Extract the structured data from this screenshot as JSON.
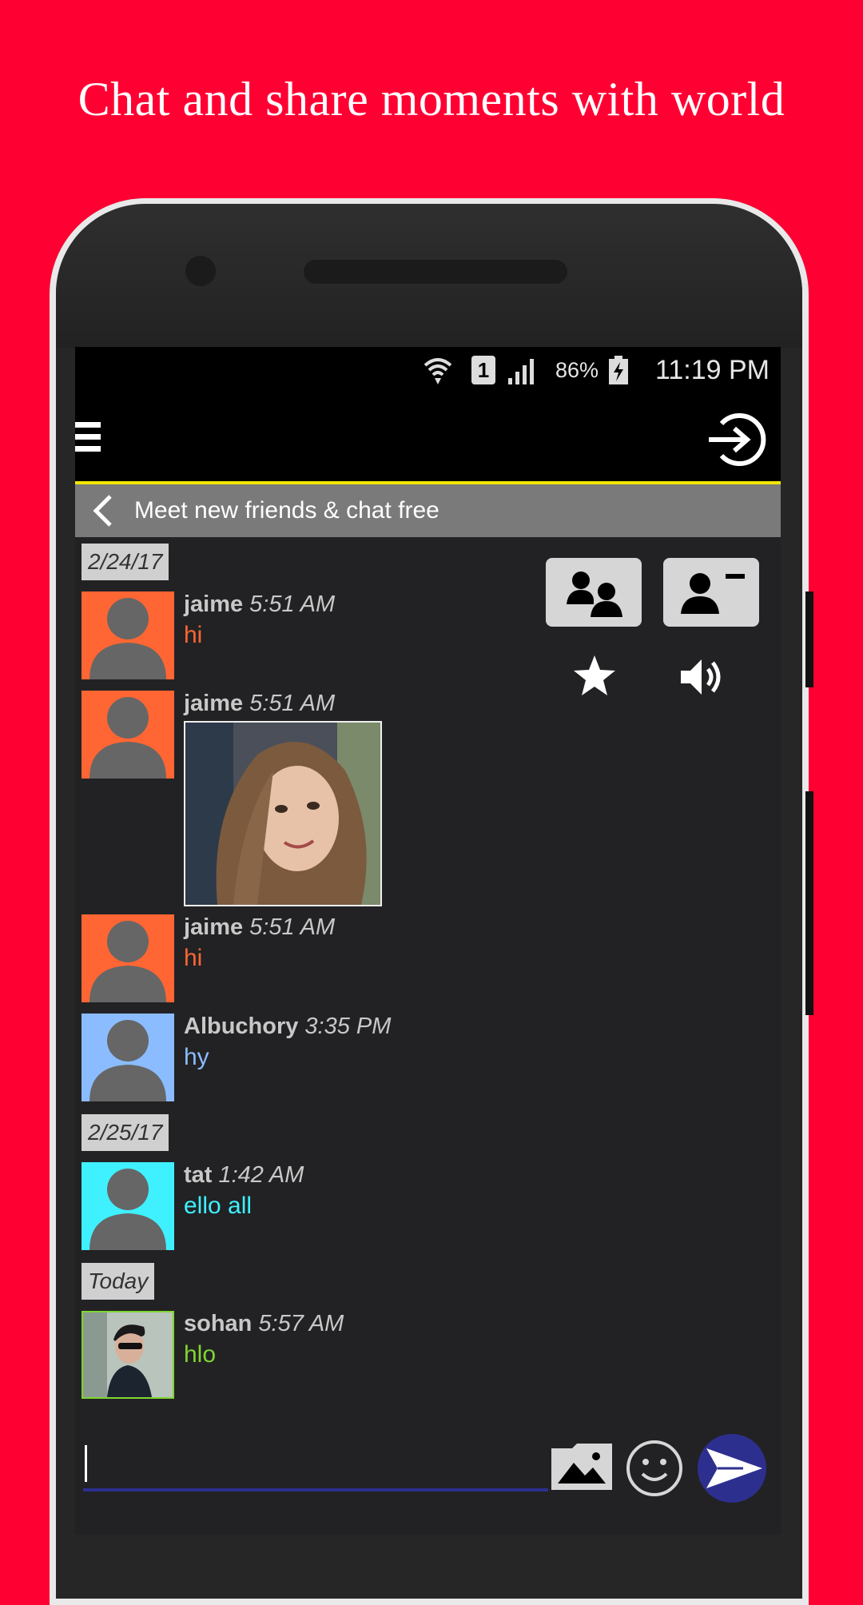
{
  "promo": {
    "headline": "Chat and share moments with world"
  },
  "statusbar": {
    "sim_slot": "1",
    "battery_percent": "86%",
    "time": "11:19 PM"
  },
  "header": {
    "subtitle": "Meet new friends & chat free"
  },
  "colors": {
    "background": "#ff0033",
    "accent_line": "#f2e600",
    "orange_user": "#ff6633",
    "blue_user": "#8bbcff",
    "cyan_user": "#3ff0ff",
    "green_user": "#7fd630",
    "send_button": "#2d2f8f"
  },
  "toolbar": {
    "icons": [
      "group-users-icon",
      "remove-user-icon",
      "star-icon",
      "volume-icon"
    ]
  },
  "chat": {
    "dates": [
      "2/24/17",
      "2/25/17",
      "Today"
    ],
    "messages": [
      {
        "name": "jaime",
        "time": "5:51 AM",
        "text": "hi",
        "color": "#ff6633"
      },
      {
        "name": "jaime",
        "time": "5:51 AM",
        "text": "",
        "type": "photo"
      },
      {
        "name": "jaime",
        "time": "5:51 AM",
        "text": "hi",
        "color": "#ff6633"
      },
      {
        "name": "Albuchory",
        "time": "3:35 PM",
        "text": "hy",
        "color": "#8bbcff"
      },
      {
        "name": "tat",
        "time": "1:42 AM",
        "text": "ello all",
        "color": "#3ff0ff"
      },
      {
        "name": "sohan",
        "time": "5:57 AM",
        "text": "hlo",
        "color": "#7fd630"
      }
    ]
  },
  "composer": {
    "input_value": "",
    "icons": [
      "image-icon",
      "emoji-icon",
      "send-icon"
    ]
  }
}
